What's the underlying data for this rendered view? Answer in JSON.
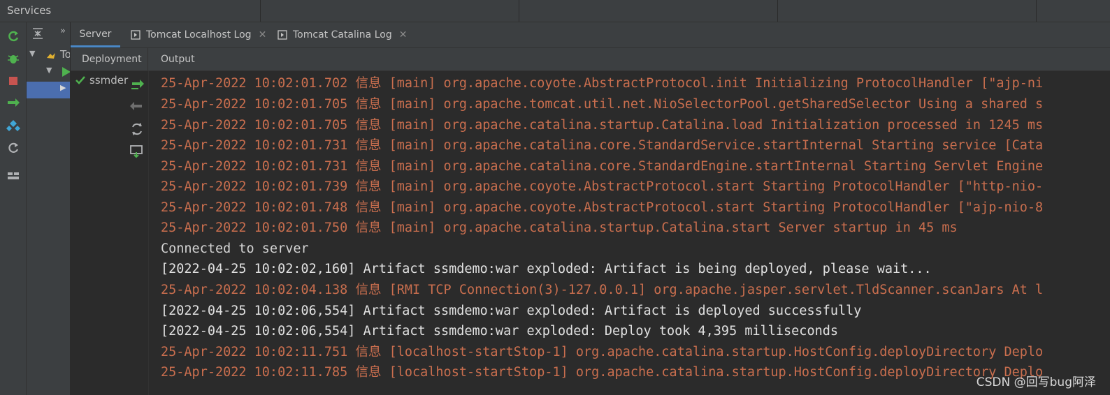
{
  "window": {
    "title": "Services"
  },
  "tree": {
    "root_label": "To",
    "deployment_label": "ssmder"
  },
  "tabs": [
    {
      "label": "Server"
    },
    {
      "label": "Tomcat Localhost Log"
    },
    {
      "label": "Tomcat Catalina Log"
    }
  ],
  "subheaders": {
    "deployment": "Deployment",
    "output": "Output"
  },
  "output_lines": [
    {
      "type": "log",
      "text": "25-Apr-2022 10:02:01.702 信息 [main] org.apache.coyote.AbstractProtocol.init Initializing ProtocolHandler [\"ajp-ni"
    },
    {
      "type": "log",
      "text": "25-Apr-2022 10:02:01.705 信息 [main] org.apache.tomcat.util.net.NioSelectorPool.getSharedSelector Using a shared s"
    },
    {
      "type": "log",
      "text": "25-Apr-2022 10:02:01.705 信息 [main] org.apache.catalina.startup.Catalina.load Initialization processed in 1245 ms"
    },
    {
      "type": "log",
      "text": "25-Apr-2022 10:02:01.731 信息 [main] org.apache.catalina.core.StandardService.startInternal Starting service [Cata"
    },
    {
      "type": "log",
      "text": "25-Apr-2022 10:02:01.731 信息 [main] org.apache.catalina.core.StandardEngine.startInternal Starting Servlet Engine"
    },
    {
      "type": "log",
      "text": "25-Apr-2022 10:02:01.739 信息 [main] org.apache.coyote.AbstractProtocol.start Starting ProtocolHandler [\"http-nio-"
    },
    {
      "type": "log",
      "text": "25-Apr-2022 10:02:01.748 信息 [main] org.apache.coyote.AbstractProtocol.start Starting ProtocolHandler [\"ajp-nio-8"
    },
    {
      "type": "log",
      "text": "25-Apr-2022 10:02:01.750 信息 [main] org.apache.catalina.startup.Catalina.start Server startup in 45 ms"
    },
    {
      "type": "plain",
      "text": "Connected to server"
    },
    {
      "type": "status",
      "text": "[2022-04-25 10:02:02,160] Artifact ssmdemo:war exploded: Artifact is being deployed, please wait..."
    },
    {
      "type": "log",
      "text": "25-Apr-2022 10:02:04.138 信息 [RMI TCP Connection(3)-127.0.0.1] org.apache.jasper.servlet.TldScanner.scanJars At l"
    },
    {
      "type": "status",
      "text": "[2022-04-25 10:02:06,554] Artifact ssmdemo:war exploded: Artifact is deployed successfully"
    },
    {
      "type": "status",
      "text": "[2022-04-25 10:02:06,554] Artifact ssmdemo:war exploded: Deploy took 4,395 milliseconds"
    },
    {
      "type": "log",
      "text": "25-Apr-2022 10:02:11.751 信息 [localhost-startStop-1] org.apache.catalina.startup.HostConfig.deployDirectory Deplo"
    },
    {
      "type": "log",
      "text": "25-Apr-2022 10:02:11.785 信息 [localhost-startStop-1] org.apache.catalina.startup.HostConfig.deployDirectory Deplo"
    }
  ],
  "watermark": "CSDN @回写bug阿泽",
  "colors": {
    "log": "#c96e4e",
    "plain": "#d4d4d4",
    "accent": "#4a88c7",
    "selection": "#4b6eaf"
  }
}
